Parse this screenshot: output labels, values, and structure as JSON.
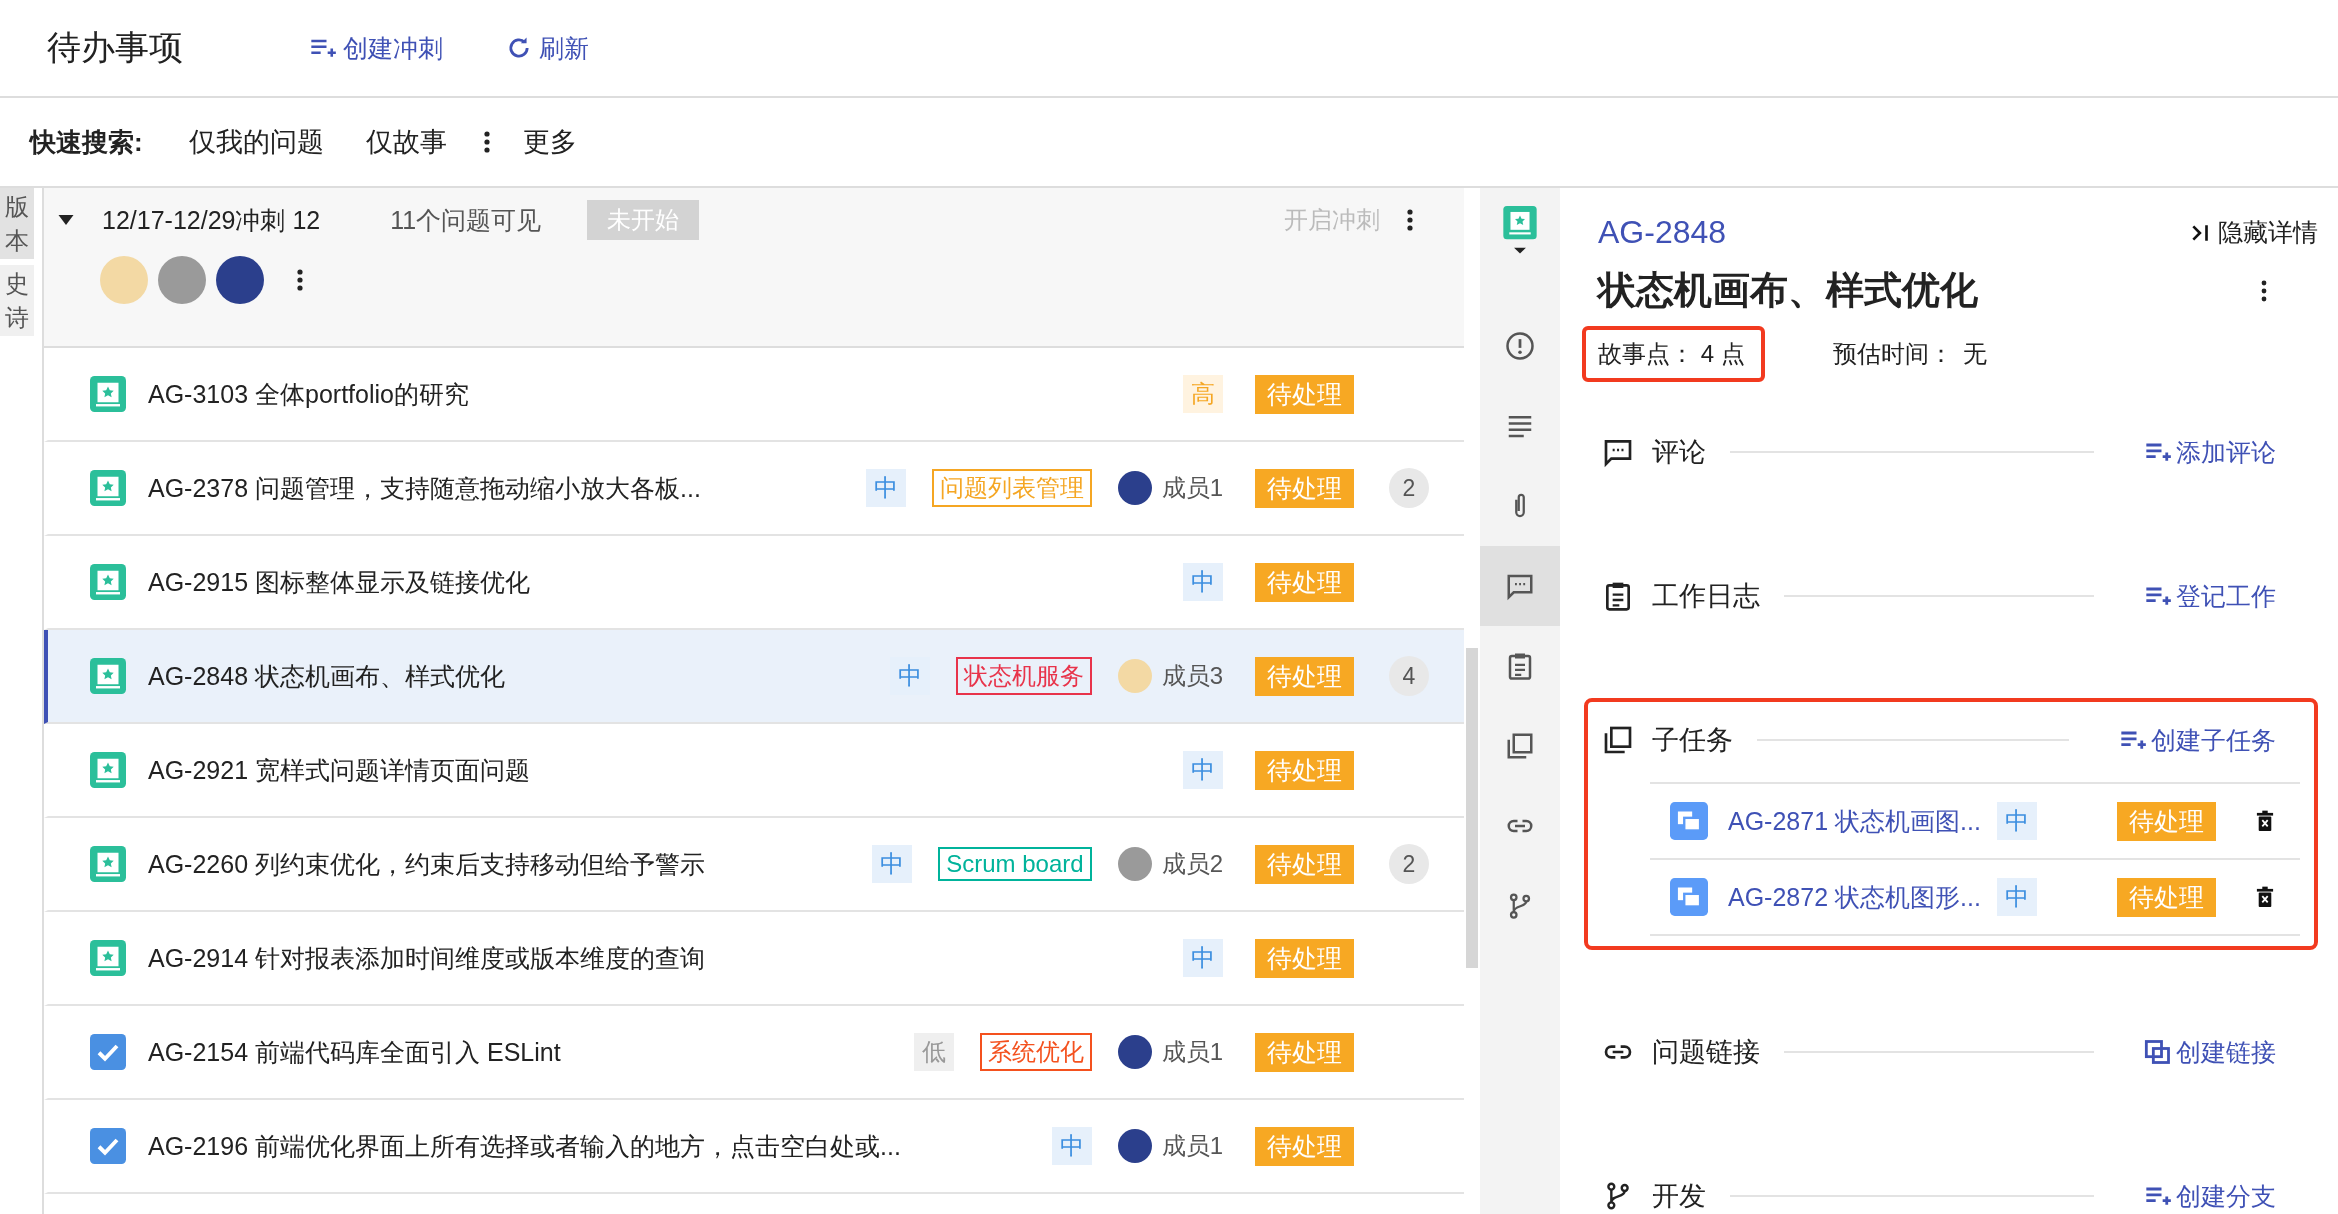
{
  "header": {
    "title": "待办事项",
    "actions": [
      {
        "kind": "create",
        "label": "创建冲刺"
      },
      {
        "kind": "refresh",
        "label": "刷新"
      }
    ]
  },
  "quick_search": {
    "label": "快速搜索:",
    "filters": [
      "仅我的问题",
      "仅故事"
    ],
    "more": "更多"
  },
  "side_tabs": [
    {
      "label": "版本",
      "selected": true
    },
    {
      "label": "史诗",
      "selected": false
    }
  ],
  "sprint": {
    "expanded": true,
    "title": "12/17-12/29冲刺 12",
    "count": "11个问题可见",
    "status": "未开始",
    "start": {
      "label": "开启冲刺",
      "disabled": true
    },
    "members": [
      {
        "color": "#f3d9a4"
      },
      {
        "color": "#9a9a9a"
      },
      {
        "color": "#2b3f8c"
      }
    ]
  },
  "rows": [
    {
      "kind": "story",
      "text": "AG-3103 全体portfolio的研究",
      "priority": {
        "text": "高",
        "kind": "high"
      },
      "status": "待处理",
      "selected": false
    },
    {
      "kind": "story",
      "text": "AG-2378 问题管理，支持随意拖动缩小放大各板...",
      "priority": {
        "text": "中",
        "kind": "medium"
      },
      "label": {
        "text": "问题列表管理",
        "color": "#f5a623"
      },
      "assignee": {
        "name": "成员1",
        "color": "#2b3f8c"
      },
      "status": "待处理",
      "count": "2",
      "selected": false
    },
    {
      "kind": "story",
      "text": "AG-2915 图标整体显示及链接优化",
      "priority": {
        "text": "中",
        "kind": "medium"
      },
      "status": "待处理",
      "selected": false
    },
    {
      "kind": "story",
      "text": "AG-2848 状态机画布、样式优化",
      "priority": {
        "text": "中",
        "kind": "medium"
      },
      "label": {
        "text": "状态机服务",
        "color": "#e8334a"
      },
      "assignee": {
        "name": "成员3",
        "color": "#f3d9a4"
      },
      "status": "待处理",
      "count": "4",
      "selected": true
    },
    {
      "kind": "story",
      "text": "AG-2921 宽样式问题详情页面问题",
      "priority": {
        "text": "中",
        "kind": "medium"
      },
      "status": "待处理",
      "selected": false
    },
    {
      "kind": "story",
      "text": "AG-2260 列约束优化，约束后支持移动但给予警示",
      "priority": {
        "text": "中",
        "kind": "medium"
      },
      "label": {
        "text": "Scrum board",
        "color": "#00b39b"
      },
      "assignee": {
        "name": "成员2",
        "color": "#9a9a9a"
      },
      "status": "待处理",
      "count": "2",
      "selected": false
    },
    {
      "kind": "story",
      "text": "AG-2914 针对报表添加时间维度或版本维度的查询",
      "priority": {
        "text": "中",
        "kind": "medium"
      },
      "status": "待处理",
      "selected": false
    },
    {
      "kind": "task",
      "text": "AG-2154 前端代码库全面引入 ESLint",
      "priority": {
        "text": "低",
        "kind": "low"
      },
      "label": {
        "text": "系统优化",
        "color": "#f4511e"
      },
      "assignee": {
        "name": "成员1",
        "color": "#2b3f8c"
      },
      "status": "待处理",
      "selected": false
    },
    {
      "kind": "task",
      "text": "AG-2196 前端优化界面上所有选择或者输入的地方，点击空白处或...",
      "priority": {
        "text": "中",
        "kind": "medium"
      },
      "assignee": {
        "name": "成员1",
        "color": "#2b3f8c"
      },
      "status": "待处理",
      "selected": false
    }
  ],
  "icon_bar": [
    {
      "kind": "story",
      "selected": false
    },
    {
      "kind": "issue",
      "selected": false
    },
    {
      "kind": "description",
      "selected": false
    },
    {
      "kind": "attachment",
      "selected": false
    },
    {
      "kind": "comment",
      "selected": true
    },
    {
      "kind": "worklog",
      "selected": false
    },
    {
      "kind": "subtask",
      "selected": false
    },
    {
      "kind": "link",
      "selected": false
    },
    {
      "kind": "branch",
      "selected": false
    }
  ],
  "detail": {
    "key": "AG-2848",
    "hide": "隐藏详情",
    "title": "状态机画布、样式优化",
    "story_points": {
      "text": "故事点： 4 点",
      "highlighted": true
    },
    "estimate": {
      "label": "预估时间：",
      "value": "无"
    },
    "sections": [
      {
        "kind": "comments",
        "title": "评论",
        "action": {
          "kind": "add",
          "label": "添加评论"
        },
        "highlighted": false
      },
      {
        "kind": "worklog",
        "title": "工作日志",
        "action": {
          "kind": "add",
          "label": "登记工作"
        },
        "highlighted": false
      },
      {
        "kind": "subtasks",
        "title": "子任务",
        "action": {
          "kind": "add",
          "label": "创建子任务"
        },
        "highlighted": true,
        "items": [
          {
            "text": "AG-2871 状态机画图...",
            "priority": "中",
            "status": "待处理"
          },
          {
            "text": "AG-2872 状态机图形...",
            "priority": "中",
            "status": "待处理"
          }
        ]
      },
      {
        "kind": "links",
        "title": "问题链接",
        "action": {
          "kind": "link",
          "label": "创建链接"
        },
        "highlighted": false
      },
      {
        "kind": "development",
        "title": "开发",
        "action": {
          "kind": "add",
          "label": "创建分支"
        },
        "highlighted": false
      }
    ]
  }
}
